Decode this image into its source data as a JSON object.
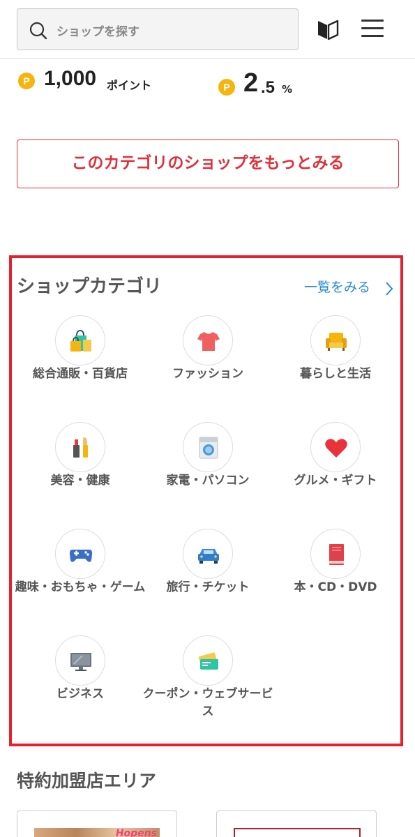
{
  "header": {
    "search_placeholder": "ショップを探す",
    "icons": [
      "search-icon",
      "beginner-mark-icon",
      "hamburger-menu-icon"
    ]
  },
  "points": {
    "coin_symbol": "P",
    "left_value": "1,000",
    "left_unit": "ポイント",
    "right_big": "2",
    "right_small": ".5",
    "right_unit": "%"
  },
  "more_button": {
    "label": "このカテゴリのショップをもっとみる"
  },
  "categories": {
    "title": "ショップカテゴリ",
    "see_all": "一覧をみる",
    "items": [
      {
        "label": "総合通販・百貨店",
        "icon": "shopping-bags-icon"
      },
      {
        "label": "ファッション",
        "icon": "tshirt-icon"
      },
      {
        "label": "暮らしと生活",
        "icon": "sofa-icon"
      },
      {
        "label": "美容・健康",
        "icon": "lipstick-brush-icon"
      },
      {
        "label": "家電・パソコン",
        "icon": "washing-machine-icon"
      },
      {
        "label": "グルメ・ギフト",
        "icon": "heart-icon"
      },
      {
        "label": "趣味・おもちゃ・ゲーム",
        "icon": "gamepad-icon"
      },
      {
        "label": "旅行・チケット",
        "icon": "car-icon"
      },
      {
        "label": "本・CD・DVD",
        "icon": "book-icon"
      },
      {
        "label": "ビジネス",
        "icon": "monitor-icon"
      },
      {
        "label": "クーポン・ウェブサービス",
        "icon": "coupon-card-icon"
      }
    ]
  },
  "special_area": {
    "title": "特約加盟店エリア",
    "card_1_logo": "Hopens"
  },
  "colors": {
    "accent_red": "#e0303a",
    "link_blue": "#2a8ad3",
    "coin_yellow": "#f6b40e",
    "highlight_border": "#e8202e"
  }
}
